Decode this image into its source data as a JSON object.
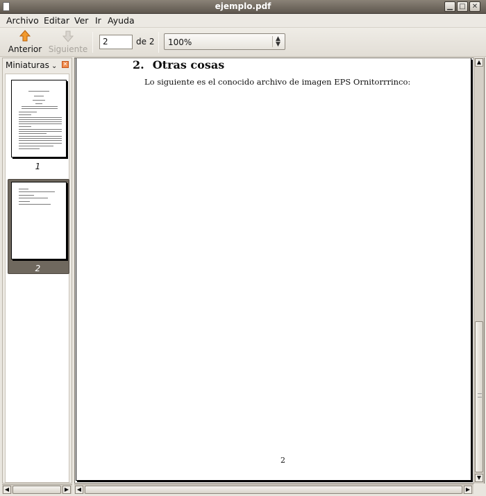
{
  "window": {
    "title": "ejemplo.pdf"
  },
  "menu": {
    "items": [
      "Archivo",
      "Editar",
      "Ver",
      "Ir",
      "Ayuda"
    ]
  },
  "toolbar": {
    "prev_label": "Anterior",
    "next_label": "Siguiente",
    "page_value": "2",
    "of_label": "de 2",
    "zoom_value": "100%"
  },
  "sidebar": {
    "header": "Miniaturas",
    "thumbnails": [
      {
        "label": "1"
      },
      {
        "label": "2",
        "selected": true
      }
    ]
  },
  "document": {
    "section_number": "2.",
    "section_title": "Otras cosas",
    "paragraph": "Lo siguiente es el conocido archivo de imagen EPS Ornitorrrinco:",
    "page_number": "2"
  },
  "colors": {
    "accent": "#f08a24",
    "selection": "#6f685e",
    "titlebar": "#6e675d"
  },
  "icons": {
    "prev": "arrow-up-icon",
    "next": "arrow-down-icon",
    "close": "close-icon"
  }
}
